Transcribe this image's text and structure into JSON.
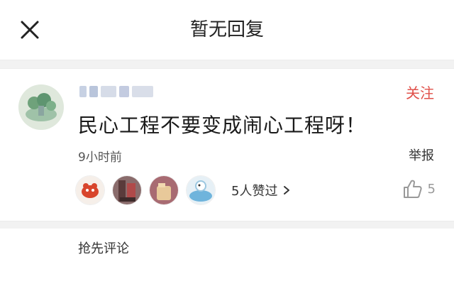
{
  "header": {
    "title": "暂无回复",
    "close_icon": "close-icon"
  },
  "comment": {
    "username": "",
    "follow_label": "关注",
    "text": "民心工程不要变成闹心工程呀！",
    "time": "9小时前",
    "report_label": "举报",
    "liked_label": "5人赞过",
    "like_count": "5"
  },
  "footer": {
    "comment_first_label": "抢先评论"
  },
  "colors": {
    "accent": "#e0504a"
  }
}
